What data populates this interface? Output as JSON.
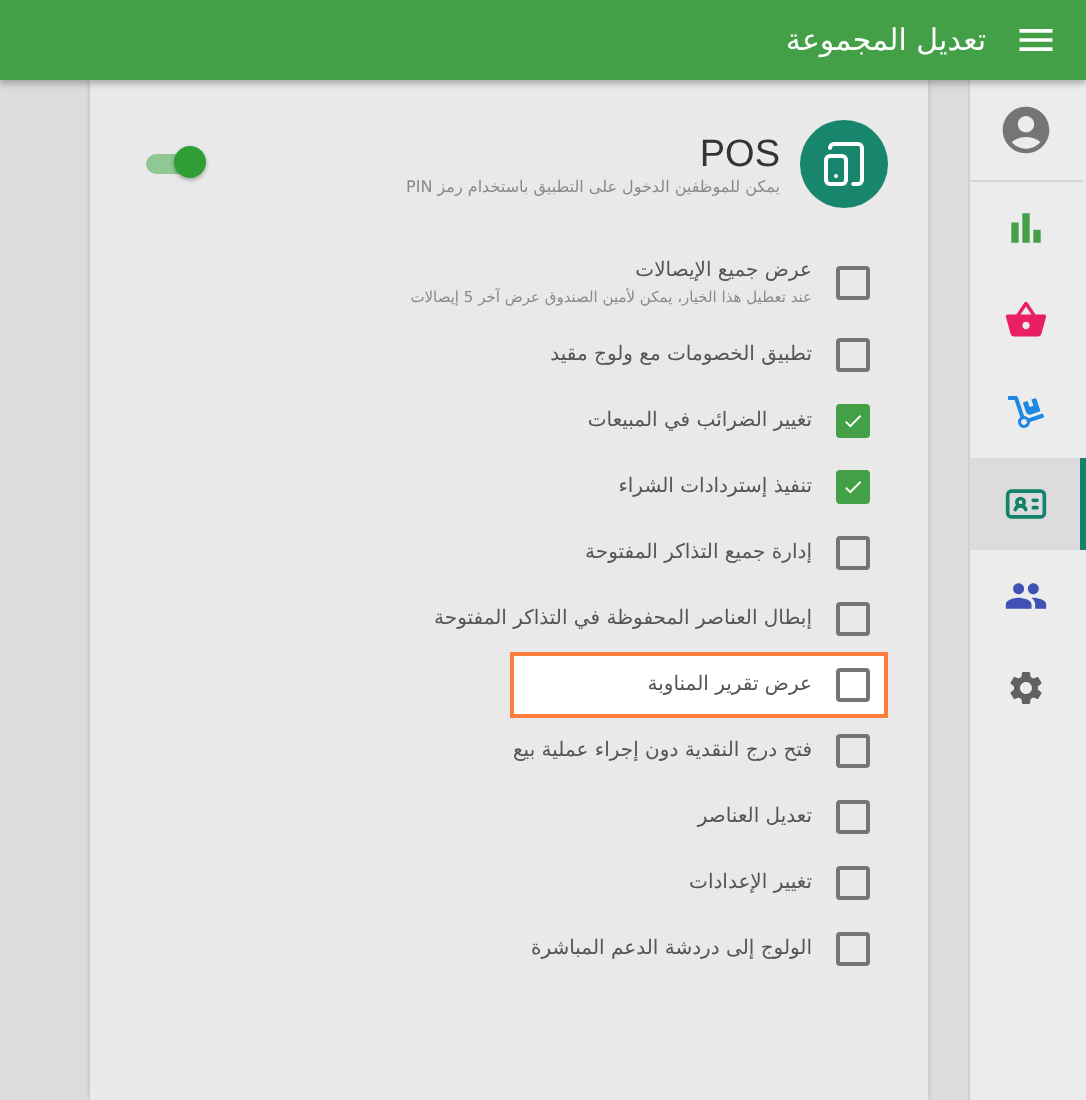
{
  "app_bar": {
    "title": "تعديل المجموعة"
  },
  "nav_rail": [
    {
      "kind": "account",
      "color": "#757575",
      "selected": false
    },
    {
      "kind": "reports",
      "color": "#43a047",
      "selected": false
    },
    {
      "kind": "basket",
      "color": "#e91e63",
      "selected": false
    },
    {
      "kind": "inventory",
      "color": "#1e88e5",
      "selected": false
    },
    {
      "kind": "employees",
      "color": "#12836b",
      "selected": true
    },
    {
      "kind": "customers",
      "color": "#3f51b5",
      "selected": false
    },
    {
      "kind": "settings",
      "color": "#616161",
      "selected": false
    }
  ],
  "card": {
    "title": "POS",
    "subtitle": "يمكن للموظفين الدخول على التطبيق باستخدام رمز PIN",
    "enabled": true,
    "permissions": [
      {
        "label": "عرض جميع الإيصالات",
        "hint": "عند تعطيل هذا الخيار، يمكن لأمين الصندوق عرض آخر 5 إيصالات",
        "checked": false,
        "highlighted": false
      },
      {
        "label": "تطبيق الخصومات مع ولوج مقيد",
        "checked": false,
        "highlighted": false
      },
      {
        "label": "تغيير الضرائب في المبيعات",
        "checked": true,
        "highlighted": false
      },
      {
        "label": "تنفيذ إستردادات الشراء",
        "checked": true,
        "highlighted": false
      },
      {
        "label": "إدارة جميع التذاكر المفتوحة",
        "checked": false,
        "highlighted": false
      },
      {
        "label": "إبطال العناصر المحفوظة في التذاكر المفتوحة",
        "checked": false,
        "highlighted": false
      },
      {
        "label": "عرض تقرير المناوبة",
        "checked": false,
        "highlighted": true
      },
      {
        "label": "فتح درج النقدية دون إجراء عملية بيع",
        "checked": false,
        "highlighted": false
      },
      {
        "label": "تعديل العناصر",
        "checked": false,
        "highlighted": false
      },
      {
        "label": "تغيير الإعدادات",
        "checked": false,
        "highlighted": false
      },
      {
        "label": "الولوج إلى دردشة الدعم المباشرة",
        "checked": false,
        "highlighted": false
      }
    ]
  }
}
